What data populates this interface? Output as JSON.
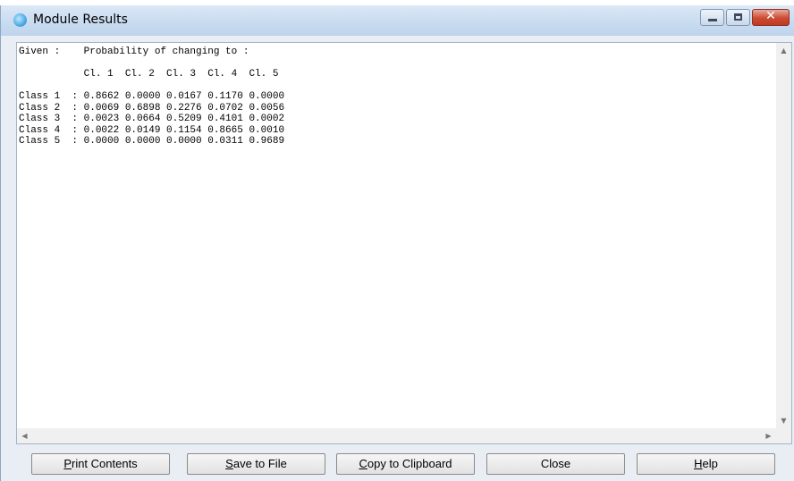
{
  "window": {
    "title": "Module Results"
  },
  "output": {
    "text": "Given :    Probability of changing to :\n\n           Cl. 1  Cl. 2  Cl. 3  Cl. 4  Cl. 5\n\nClass 1  : 0.8662 0.0000 0.0167 0.1170 0.0000\nClass 2  : 0.0069 0.6898 0.2276 0.0702 0.0056\nClass 3  : 0.0023 0.0664 0.5209 0.4101 0.0002\nClass 4  : 0.0022 0.0149 0.1154 0.8665 0.0010\nClass 5  : 0.0000 0.0000 0.0000 0.0311 0.9689"
  },
  "buttons": {
    "print_mnemonic": "P",
    "print_rest": "rint Contents",
    "save_mnemonic": "S",
    "save_rest": "ave to File",
    "copy_mnemonic": "C",
    "copy_rest": "opy to Clipboard",
    "close_label": "Close",
    "help_mnemonic": "H",
    "help_rest": "elp"
  },
  "icons": {
    "app": "module-app-icon",
    "minimize": "minimize-icon",
    "maximize": "maximize-icon",
    "close": "close-icon"
  },
  "colors": {
    "close_button": "#c94a32",
    "titlebar": "#c7dbf0"
  }
}
